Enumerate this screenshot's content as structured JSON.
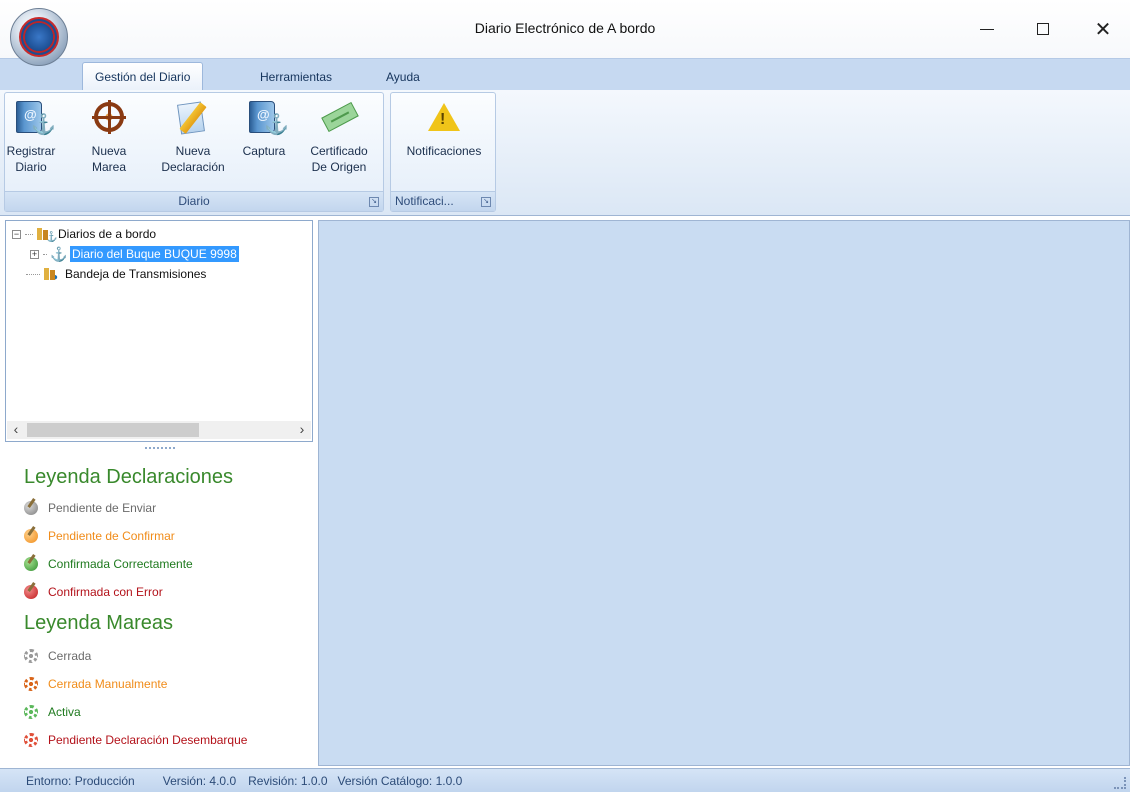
{
  "window": {
    "title": "Diario Electrónico de A bordo",
    "controls": [
      "minimize-icon",
      "maximize-icon",
      "close-icon"
    ]
  },
  "ribbon": {
    "tabs": [
      {
        "label": "Gestión del Diario",
        "active": true
      },
      {
        "label": "Herramientas",
        "active": false
      },
      {
        "label": "Ayuda",
        "active": false
      }
    ],
    "groups": [
      {
        "caption": "Diario",
        "buttons": [
          {
            "label_line1": "Registrar",
            "label_line2": "Diario",
            "icon": "journal-anchor-icon"
          },
          {
            "label_line1": "Nueva",
            "label_line2": "Marea",
            "icon": "ship-wheel-icon"
          },
          {
            "label_line1": "Nueva",
            "label_line2": "Declaración",
            "icon": "edit-document-icon"
          },
          {
            "label_line1": "Captura",
            "label_line2": "",
            "icon": "journal-anchor-icon"
          },
          {
            "label_line1": "Certificado",
            "label_line2": "De Origen",
            "icon": "certificate-ticket-icon"
          }
        ]
      },
      {
        "caption": "Notificaci...",
        "buttons": [
          {
            "label_line1": "Notificaciones",
            "label_line2": "",
            "icon": "warning-icon"
          }
        ]
      }
    ]
  },
  "tree": {
    "root": {
      "label": "Diarios de a bordo",
      "icon": "logbooks-folder-icon",
      "expanded": true
    },
    "child": {
      "label": "Diario del Buque BUQUE 9998",
      "icon": "anchor-icon",
      "selected": true,
      "expanded": false
    },
    "inbox": {
      "label": "Bandeja de Transmisiones",
      "icon": "transmissions-folder-icon"
    }
  },
  "legend": {
    "declarations_title": "Leyenda Declaraciones",
    "declarations": [
      {
        "label": "Pendiente de Enviar",
        "color": "#6b6b6b"
      },
      {
        "label": "Pendiente de Confirmar",
        "color": "#f08c1a"
      },
      {
        "label": "Confirmada Correctamente",
        "color": "#1f7a1f"
      },
      {
        "label": "Confirmada con Error",
        "color": "#b3121a"
      }
    ],
    "tides_title": "Leyenda Mareas",
    "tides": [
      {
        "label": "Cerrada",
        "color": "#6b6b6b"
      },
      {
        "label": "Cerrada Manualmente",
        "color": "#f08c1a"
      },
      {
        "label": "Activa",
        "color": "#1f7a1f"
      },
      {
        "label": "Pendiente Declaración Desembarque",
        "color": "#b3121a"
      }
    ]
  },
  "status": {
    "environment": "Entorno: Producción",
    "version": "Versión: 4.0.0",
    "revision": "Revisión: 1.0.0",
    "catalog_version": "Versión Catálogo: 1.0.0"
  },
  "colors": {
    "accent": "#3399ff",
    "legend_title": "#39892c",
    "main_background": "#c9dcf2"
  }
}
